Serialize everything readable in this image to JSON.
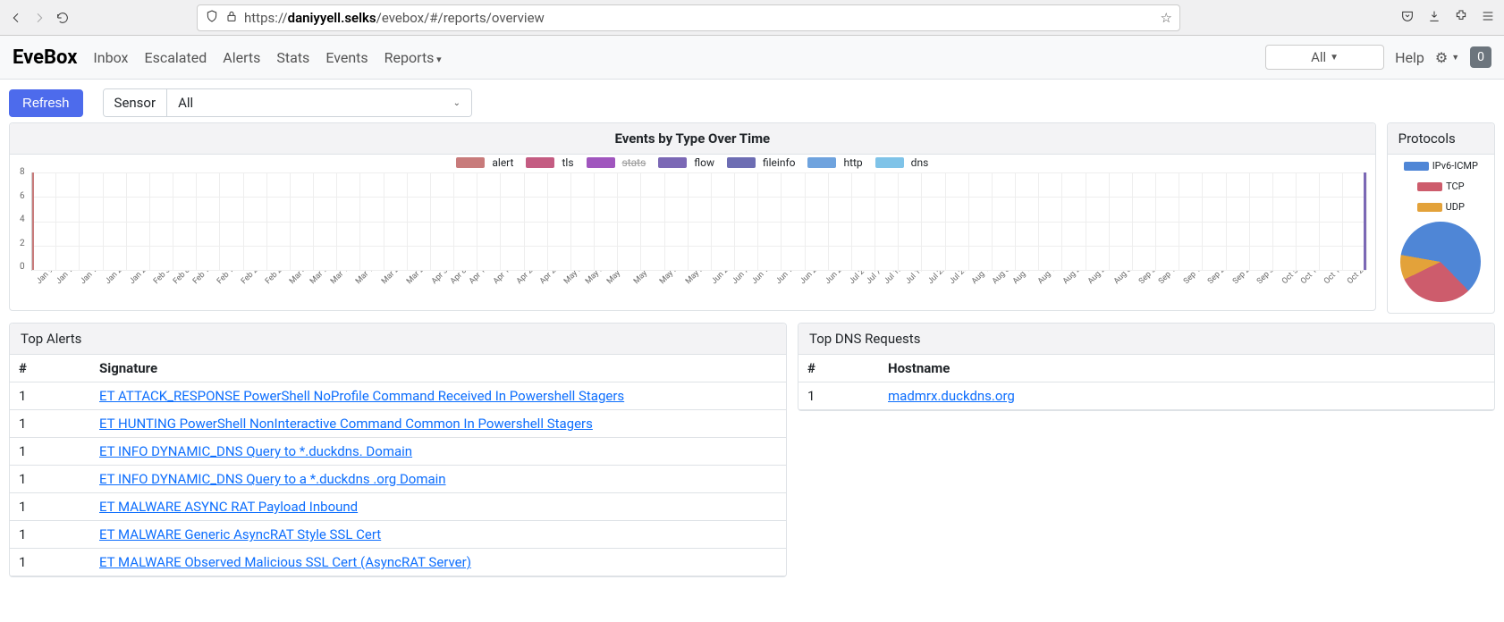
{
  "browser": {
    "url_prefix": "https://",
    "url_domain": "daniyyell.selks",
    "url_path": "/evebox/#/reports/overview"
  },
  "navbar": {
    "brand": "EveBox",
    "links": [
      "Inbox",
      "Escalated",
      "Alerts",
      "Stats",
      "Events",
      "Reports"
    ],
    "time_selector": "All",
    "help": "Help",
    "badge": "0"
  },
  "toolbar": {
    "refresh": "Refresh",
    "sensor_label": "Sensor",
    "sensor_value": "All"
  },
  "events_chart": {
    "title": "Events by Type Over Time"
  },
  "protocols_card": {
    "title": "Protocols"
  },
  "top_alerts": {
    "title": "Top Alerts",
    "columns": [
      "#",
      "Signature"
    ],
    "rows": [
      {
        "count": "1",
        "sig": "ET ATTACK_RESPONSE PowerShell NoProfile Command Received In Powershell Stagers"
      },
      {
        "count": "1",
        "sig": "ET HUNTING PowerShell NonInteractive Command Common In Powershell Stagers"
      },
      {
        "count": "1",
        "sig": "ET INFO DYNAMIC_DNS Query to *.duckdns. Domain"
      },
      {
        "count": "1",
        "sig": "ET INFO DYNAMIC_DNS Query to a *.duckdns .org Domain"
      },
      {
        "count": "1",
        "sig": "ET MALWARE ASYNC RAT Payload Inbound"
      },
      {
        "count": "1",
        "sig": "ET MALWARE Generic AsyncRAT Style SSL Cert"
      },
      {
        "count": "1",
        "sig": "ET MALWARE Observed Malicious SSL Cert (AsyncRAT Server)"
      }
    ]
  },
  "top_dns": {
    "title": "Top DNS Requests",
    "columns": [
      "#",
      "Hostname"
    ],
    "rows": [
      {
        "count": "1",
        "host": "madmrx.duckdns.org"
      }
    ]
  },
  "chart_data": [
    {
      "type": "line",
      "title": "Events by Type Over Time",
      "ylim": [
        0,
        8
      ],
      "yticks": [
        0,
        2,
        4,
        6,
        8
      ],
      "legend": [
        {
          "label": "alert",
          "color": "#c87b7b",
          "hidden": false
        },
        {
          "label": "tls",
          "color": "#c45c82",
          "hidden": false
        },
        {
          "label": "stats",
          "color": "#a056be",
          "hidden": true
        },
        {
          "label": "flow",
          "color": "#7b68b5",
          "hidden": false
        },
        {
          "label": "fileinfo",
          "color": "#6d6db3",
          "hidden": false
        },
        {
          "label": "http",
          "color": "#6fa3de",
          "hidden": false
        },
        {
          "label": "dns",
          "color": "#7fc3e8",
          "hidden": false
        }
      ],
      "categories": [
        "Jan 9",
        "Jan 14",
        "Jan 19",
        "Jan 24",
        "Jan 29",
        "Feb 3",
        "Feb 8",
        "Feb 13",
        "Feb 18",
        "Feb 23",
        "Feb 28",
        "Mar 4",
        "Mar 9",
        "Mar 14",
        "Mar 19",
        "Mar 24",
        "Mar 29",
        "Apr 3",
        "Apr 8",
        "Apr 13",
        "Apr 18",
        "Apr 23",
        "Apr 28",
        "May 3",
        "May 8",
        "May 13",
        "May 18",
        "May 23",
        "May 28",
        "Jun 2",
        "Jun 7",
        "Jun 12",
        "Jun 17",
        "Jun 22",
        "Jun 27",
        "Jul 2",
        "Jul 7",
        "Jul 12",
        "Jul 17",
        "Jul 22",
        "Jul 27",
        "Aug 1",
        "Aug 6",
        "Aug 11",
        "Aug 16",
        "Aug 21",
        "Aug 26",
        "Aug 31",
        "Sep 5",
        "Sep 10",
        "Sep 15",
        "Sep 20",
        "Sep 25",
        "Sep 30",
        "Oct 5",
        "Oct 10",
        "Oct 15",
        "Oct 20"
      ],
      "series_note": "All series are ~0 across the range except a brief spike near Jan 9 reaching ~8 (alert) and a brief spike near Oct 20 reaching ~8 (flow)."
    },
    {
      "type": "pie",
      "title": "Protocols",
      "series": [
        {
          "name": "IPv6-ICMP",
          "value": 60,
          "color": "#4f86d6"
        },
        {
          "name": "TCP",
          "value": 30,
          "color": "#cd5c6c"
        },
        {
          "name": "UDP",
          "value": 10,
          "color": "#e3a23a"
        }
      ]
    }
  ]
}
